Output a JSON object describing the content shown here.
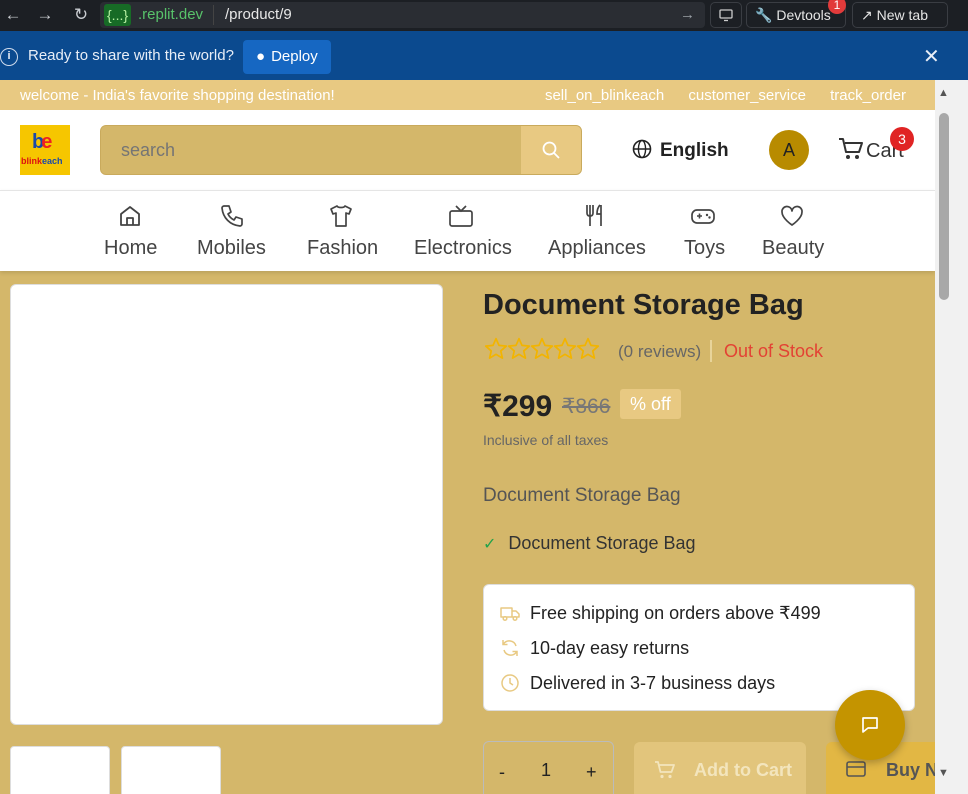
{
  "browser": {
    "url_badge": "{...}",
    "url_domain": ".replit.dev",
    "url_path": "/product/9",
    "devtools_label": "Devtools",
    "devtools_badge": "1",
    "new_tab_label": "New tab"
  },
  "replit_banner": {
    "message": "Ready to share with the world?",
    "deploy_label": "Deploy"
  },
  "top_strip": {
    "welcome": "welcome - India's favorite shopping destination!",
    "links": [
      "sell_on_blinkeach",
      "customer_service",
      "track_order"
    ]
  },
  "header": {
    "logo_text": "blinkeach",
    "search_placeholder": "search",
    "language": "English",
    "avatar_initial": "A",
    "cart_label": "Cart",
    "cart_count": "3"
  },
  "categories": [
    {
      "label": "Home",
      "icon": "home-icon"
    },
    {
      "label": "Mobiles",
      "icon": "phone-icon"
    },
    {
      "label": "Fashion",
      "icon": "shirt-icon"
    },
    {
      "label": "Electronics",
      "icon": "tv-icon"
    },
    {
      "label": "Appliances",
      "icon": "utensils-icon"
    },
    {
      "label": "Toys",
      "icon": "gamepad-icon"
    },
    {
      "label": "Beauty",
      "icon": "heart-icon"
    }
  ],
  "product": {
    "title": "Document Storage Bag",
    "rating": 0,
    "reviews": "(0 reviews)",
    "stock_status": "Out of Stock",
    "price": "₹299",
    "mrp": "₹866",
    "discount": "% off",
    "tax_note": "Inclusive of all taxes",
    "description": "Document Storage Bag",
    "features": [
      "Document Storage Bag"
    ]
  },
  "delivery_info": [
    {
      "text": "Free shipping on orders above ₹499",
      "icon": "truck-icon"
    },
    {
      "text": "10-day easy returns",
      "icon": "refresh-icon"
    },
    {
      "text": "Delivered in 3-7 business days",
      "icon": "clock-icon"
    }
  ],
  "purchase": {
    "minus": "-",
    "quantity": "1",
    "plus": "+",
    "add_to_cart": "Add to Cart",
    "buy_now": "Buy Now"
  },
  "colors": {
    "brand_gold": "#d4b76a",
    "accent_light": "#e8c982",
    "out_of_stock": "#e34234",
    "deploy_bar": "#0b4a8f"
  }
}
